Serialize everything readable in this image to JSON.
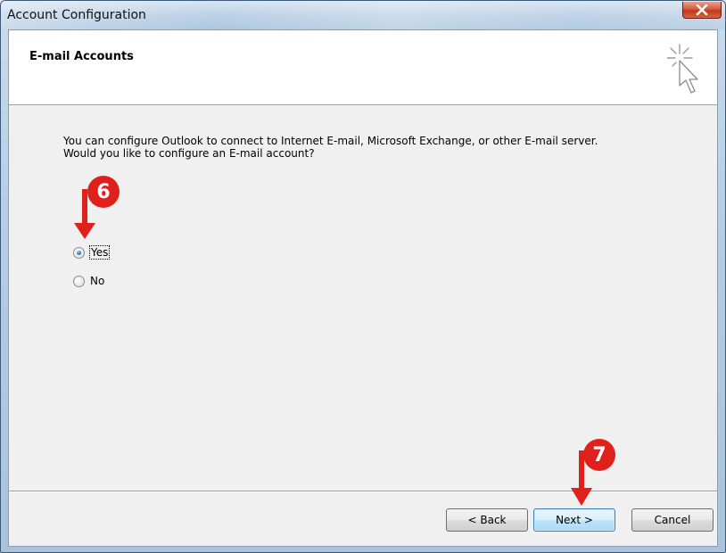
{
  "window": {
    "title": "Account Configuration"
  },
  "header": {
    "title": "E-mail Accounts",
    "icon": "wizard-cursor-icon"
  },
  "content": {
    "question": "You can configure Outlook to connect to Internet E-mail, Microsoft Exchange, or other E-mail server. Would you like to configure an E-mail account?",
    "options": [
      {
        "label": "Yes",
        "selected": true
      },
      {
        "label": "No",
        "selected": false
      }
    ]
  },
  "buttons": {
    "back": "< Back",
    "next": "Next >",
    "cancel": "Cancel"
  },
  "annotations": {
    "step6": "6",
    "step7": "7",
    "color": "#e0201b"
  },
  "colors": {
    "close_button": "#c1381c",
    "default_button_border": "#3c7fb1",
    "radio_selected": "#2f6fb0"
  }
}
